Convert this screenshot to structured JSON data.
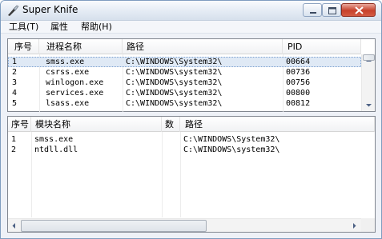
{
  "window": {
    "title": "Super Knife"
  },
  "menu": [
    {
      "label": "工具(T)"
    },
    {
      "label": "属性"
    },
    {
      "label": "帮助(H)"
    }
  ],
  "process_list": {
    "columns": [
      "序号",
      "进程名称",
      "路径",
      "PID"
    ],
    "rows": [
      {
        "index": "1",
        "name": "smss.exe",
        "path": "C:\\WINDOWS\\System32\\",
        "pid": "00664",
        "selected": true
      },
      {
        "index": "2",
        "name": "csrss.exe",
        "path": "C:\\WINDOWS\\system32\\",
        "pid": "00736"
      },
      {
        "index": "3",
        "name": "winlogon.exe",
        "path": "C:\\WINDOWS\\system32\\",
        "pid": "00756"
      },
      {
        "index": "4",
        "name": "services.exe",
        "path": "C:\\WINDOWS\\system32\\",
        "pid": "00800"
      },
      {
        "index": "5",
        "name": "lsass.exe",
        "path": "C:\\WINDOWS\\system32\\",
        "pid": "00812"
      }
    ]
  },
  "module_list": {
    "columns": [
      "序号",
      "模块名称",
      "数",
      "路径"
    ],
    "rows": [
      {
        "index": "1",
        "name": "smss.exe",
        "count": "",
        "path": "C:\\WINDOWS\\System32\\"
      },
      {
        "index": "2",
        "name": "ntdll.dll",
        "count": "",
        "path": "C:\\WINDOWS\\system32\\"
      }
    ]
  }
}
